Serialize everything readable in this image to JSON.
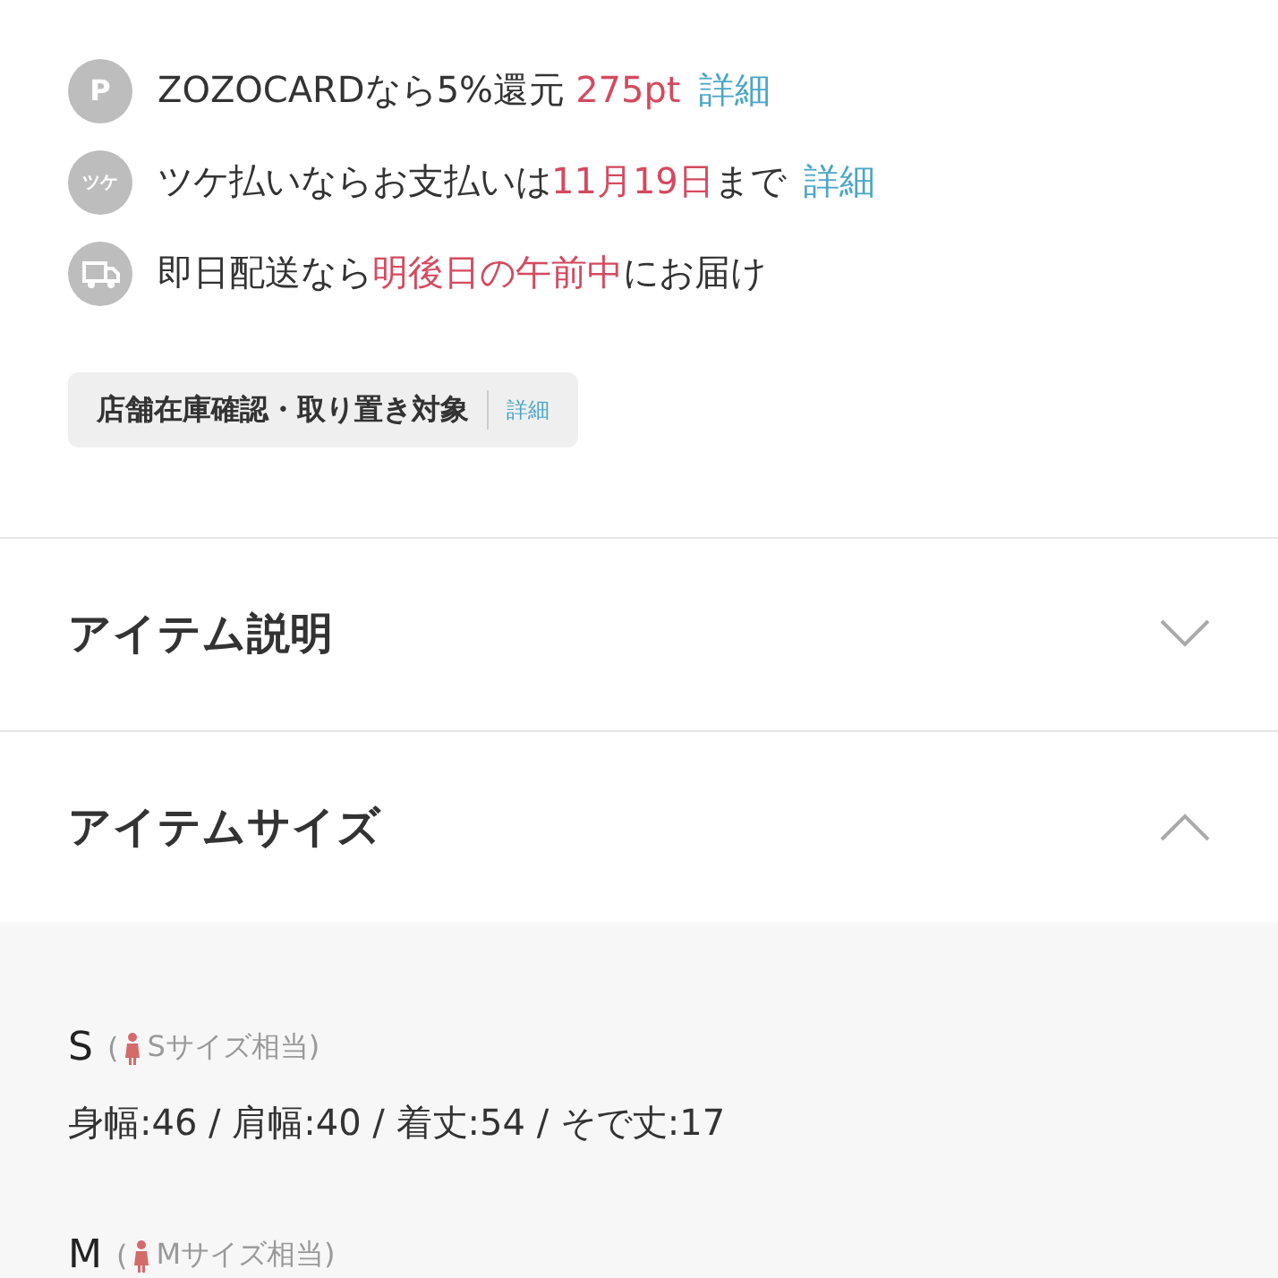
{
  "benefits": [
    {
      "kind": "letter",
      "badge": "P",
      "parts": [
        {
          "kind": "text",
          "text": "ZOZOCARDなら5%還元"
        },
        {
          "kind": "highlight",
          "text": "275pt"
        },
        {
          "kind": "link",
          "text": "詳細"
        }
      ]
    },
    {
      "kind": "letter",
      "badge": "ツケ",
      "parts": [
        {
          "kind": "text",
          "text": "ツケ払いならお支払いは"
        },
        {
          "kind": "highlight",
          "text": "11月19日"
        },
        {
          "kind": "text",
          "text": "まで"
        },
        {
          "kind": "link",
          "text": "詳細"
        }
      ]
    },
    {
      "kind": "truck",
      "parts": [
        {
          "kind": "text",
          "text": "即日配送なら"
        },
        {
          "kind": "highlight",
          "text": "明後日の午前中"
        },
        {
          "kind": "text",
          "text": "にお届け"
        }
      ]
    }
  ],
  "store_tag": {
    "label": "店舗在庫確認・取り置き対象",
    "link": "詳細"
  },
  "sections": [
    {
      "title": "アイテム説明",
      "expanded": false
    },
    {
      "title": "アイテムサイズ",
      "expanded": true
    }
  ],
  "sizes": [
    {
      "size": "S",
      "paren": "(",
      "note": "Sサイズ相当)",
      "measurements": "身幅:46 / 肩幅:40 / 着丈:54 / そで丈:17"
    },
    {
      "size": "M",
      "paren": "(",
      "note": "Mサイズ相当)"
    }
  ]
}
